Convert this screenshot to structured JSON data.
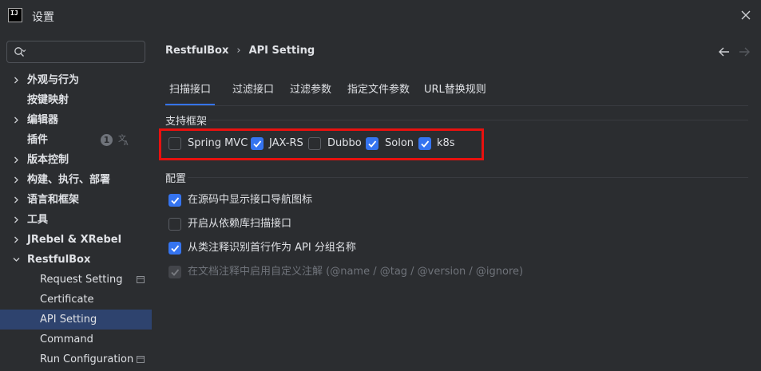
{
  "window": {
    "title": "设置",
    "app_icon_text": "IJ"
  },
  "search": {
    "placeholder": ""
  },
  "sidebar": {
    "items": [
      {
        "label": "外观与行为"
      },
      {
        "label": "按键映射"
      },
      {
        "label": "编辑器"
      },
      {
        "label": "插件",
        "badge": "1"
      },
      {
        "label": "版本控制"
      },
      {
        "label": "构建、执行、部署"
      },
      {
        "label": "语言和框架"
      },
      {
        "label": "工具"
      },
      {
        "label": "JRebel & XRebel"
      },
      {
        "label": "RestfulBox"
      },
      {
        "label": "Request Setting"
      },
      {
        "label": "Certificate"
      },
      {
        "label": "API Setting"
      },
      {
        "label": "Command"
      },
      {
        "label": "Run Configuration"
      }
    ]
  },
  "breadcrumb": {
    "parent": "RestfulBox",
    "separator": "›",
    "current": "API Setting"
  },
  "tabs": [
    {
      "label": "扫描接口",
      "active": true
    },
    {
      "label": "过滤接口"
    },
    {
      "label": "过滤参数"
    },
    {
      "label": "指定文件参数"
    },
    {
      "label": "URL替换规则"
    }
  ],
  "frameworks": {
    "title": "支持框架",
    "options": [
      {
        "label": "Spring MVC",
        "checked": false
      },
      {
        "label": "JAX-RS",
        "checked": true
      },
      {
        "label": "Dubbo",
        "checked": false
      },
      {
        "label": "Solon",
        "checked": true
      },
      {
        "label": "k8s",
        "checked": true
      }
    ]
  },
  "config": {
    "title": "配置",
    "options": [
      {
        "label": "在源码中显示接口导航图标",
        "checked": true
      },
      {
        "label": "开启从依赖库扫描接口",
        "checked": false
      },
      {
        "label": "从类注释识别首行作为 API 分组名称",
        "checked": true
      },
      {
        "label": "在文档注释中启用自定义注解 (@name / @tag / @version / @ignore)",
        "checked": true,
        "disabled": true
      }
    ]
  },
  "colors": {
    "accent": "#3574f0",
    "selection": "#2e436e",
    "background": "#2b2d30",
    "highlight_border": "#e8110f"
  },
  "icons": [
    "search-icon",
    "close-icon",
    "chevron-right-icon",
    "chevron-down-icon",
    "translate-icon",
    "page-icon",
    "arrow-left-icon",
    "arrow-right-icon",
    "checkmark-icon"
  ]
}
